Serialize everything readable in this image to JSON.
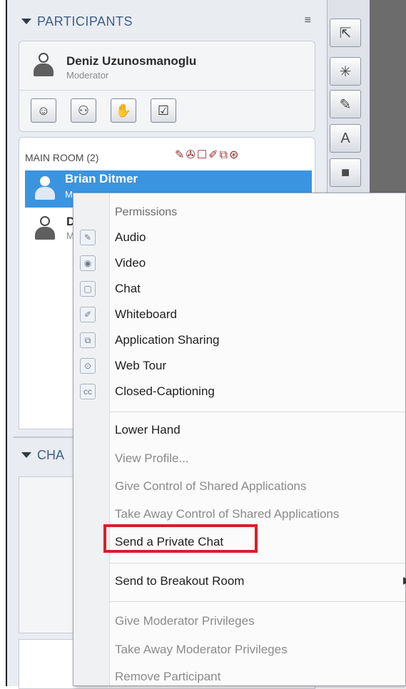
{
  "participants": {
    "header_title": "PARTICIPANTS",
    "menu_icon": "≡",
    "current_user": {
      "name": "Deniz Uzunosmanoglu",
      "role": "Moderator"
    },
    "toolbar": [
      {
        "icon": "emoticon-icon",
        "glyph": "☺"
      },
      {
        "icon": "profile-icon",
        "glyph": "⚇"
      },
      {
        "icon": "raise-hand-icon",
        "glyph": "✋"
      },
      {
        "icon": "poll-check-icon",
        "glyph": "☑"
      }
    ]
  },
  "room": {
    "label": "MAIN ROOM (2)",
    "icons": "✎✇☐✐⧉⊛",
    "rows": [
      {
        "name": "Brian Ditmer",
        "role": "M",
        "selected": true
      },
      {
        "name": "D",
        "role": "M",
        "selected": false
      }
    ]
  },
  "chat": {
    "header_title": "CHA"
  },
  "side_tools": [
    {
      "icon": "select-icon",
      "glyph": "⇱"
    },
    {
      "icon": "laser-pointer-icon",
      "glyph": "✳"
    },
    {
      "icon": "pencil-icon",
      "glyph": "✎"
    },
    {
      "icon": "text-tool-icon",
      "glyph": "A"
    },
    {
      "icon": "shape-icon",
      "glyph": "■"
    }
  ],
  "context_menu": {
    "permissions_header": "Permissions",
    "permissions": [
      {
        "label": "Audio",
        "icon": "audio-icon",
        "glyph": "✎"
      },
      {
        "label": "Video",
        "icon": "webcam-icon",
        "glyph": "◉"
      },
      {
        "label": "Chat",
        "icon": "chat-icon",
        "glyph": "▢"
      },
      {
        "label": "Whiteboard",
        "icon": "whiteboard-pencil-icon",
        "glyph": "✐"
      },
      {
        "label": "Application Sharing",
        "icon": "app-sharing-icon",
        "glyph": "⧉"
      },
      {
        "label": "Web Tour",
        "icon": "web-tour-icon",
        "glyph": "⊙"
      },
      {
        "label": "Closed-Captioning",
        "icon": "cc-icon",
        "glyph": "cc"
      }
    ],
    "actions": {
      "lower_hand": "Lower Hand",
      "view_profile": "View Profile...",
      "give_control": "Give Control of Shared Applications",
      "take_control": "Take Away Control of Shared Applications",
      "private_chat": "Send a Private Chat",
      "breakout": "Send to Breakout Room",
      "give_mod": "Give Moderator Privileges",
      "take_mod": "Take Away Moderator Privileges",
      "remove": "Remove Participant"
    },
    "submenu_arrow": "▶"
  },
  "colors": {
    "highlight": "#d61f2a",
    "selection": "#3a94e0",
    "header_text": "#3f5f86"
  }
}
